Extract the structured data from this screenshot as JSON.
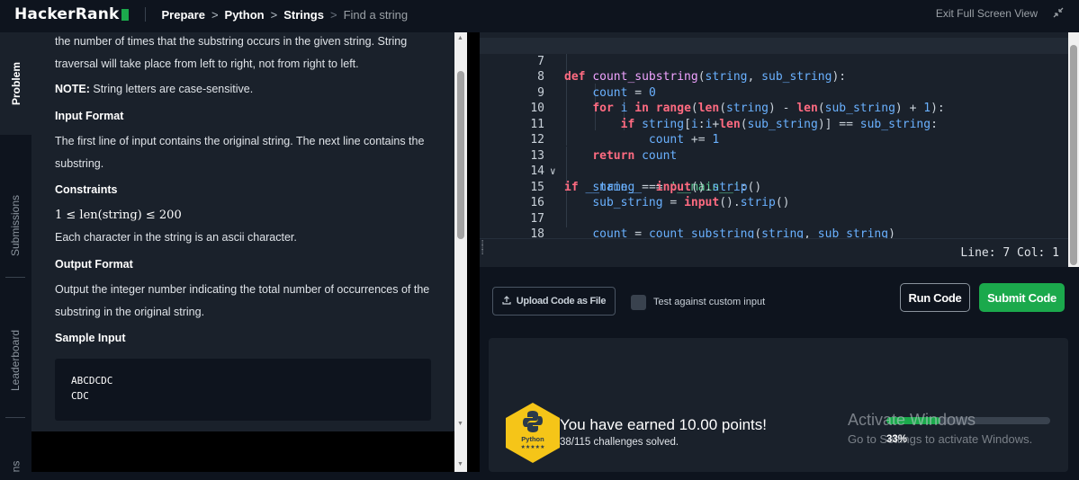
{
  "topbar": {
    "logo": "HackerRank",
    "breadcrumbs": [
      "Prepare",
      "Python",
      "Strings",
      "Find a string"
    ],
    "exit_label": "Exit Full Screen View"
  },
  "sidebar": {
    "tabs": [
      {
        "label": "Problem",
        "active": true
      },
      {
        "label": "Submissions",
        "active": false
      },
      {
        "label": "Leaderboard",
        "active": false
      },
      {
        "label": "ns",
        "active": false
      }
    ]
  },
  "problem": {
    "intro": "the number of times that the substring occurs in the given string. String traversal will take place from left to right, not from right to left.",
    "note_label": "NOTE:",
    "note_text": " String letters are case-sensitive.",
    "input_format_heading": "Input Format",
    "input_format_text": "The first line of input contains the original string. The next line contains the substring.",
    "constraints_heading": "Constraints",
    "constraint_math": "1 ≤ len(string) ≤ 200",
    "constraint_text": "Each character in the string is an ascii character.",
    "output_format_heading": "Output Format",
    "output_format_text": "Output the integer number indicating the total number of occurrences of the substring in the original string.",
    "sample_input_heading": "Sample Input",
    "sample_input_lines": [
      "ABCDCDC",
      "CDC"
    ]
  },
  "editor": {
    "line_numbers": [
      "7",
      "8",
      "9",
      "10",
      "11",
      "12",
      "13",
      "14",
      "15",
      "16",
      "17",
      "18"
    ],
    "status": "Line: 7 Col: 1"
  },
  "actions": {
    "upload_label": "Upload Code as File",
    "custom_input_label": "Test against custom input",
    "run_label": "Run Code",
    "submit_label": "Submit Code"
  },
  "result": {
    "badge_label": "Python",
    "badge_stars": "★★★★★",
    "earned_text": "You have earned 10.00 points!",
    "solved_text": "38/115 challenges solved.",
    "progress_percent": 33,
    "progress_label": "33%",
    "watermark_title": "Activate Windows",
    "watermark_sub": "Go to Settings to activate Windows."
  },
  "colors": {
    "brand_green": "#1ba94c",
    "background": "#0e141e",
    "panel": "#1a212b",
    "badge_yellow": "#f5c518"
  }
}
